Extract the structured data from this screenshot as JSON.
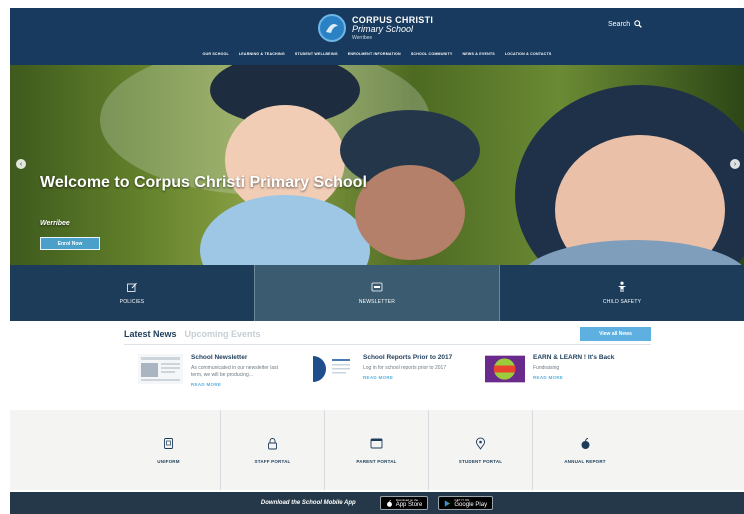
{
  "header": {
    "logo_line1": "CORPUS CHRISTI",
    "logo_line2": "Primary School",
    "logo_line3": "Werribee",
    "search_label": "Search",
    "nav": [
      "OUR SCHOOL",
      "LEARNING & TEACHING",
      "STUDENT WELLBEING",
      "ENROLMENT INFORMATION",
      "SCHOOL COMMUNITY",
      "NEWS & EVENTS",
      "LOCATION & CONTACTS"
    ]
  },
  "hero": {
    "title": "Welcome to Corpus Christi Primary School",
    "subtitle": "Werribee",
    "button": "Enrol Now"
  },
  "tiles": [
    {
      "label": "POLICIES",
      "icon": "edit-icon"
    },
    {
      "label": "NEWSLETTER",
      "icon": "pdf-icon"
    },
    {
      "label": "CHILD SAFETY",
      "icon": "child-icon"
    }
  ],
  "news": {
    "tab_active": "Latest News",
    "tab_inactive": "Upcoming Events",
    "view_all": "View all News",
    "items": [
      {
        "title": "School Newsletter",
        "body": "As communicated in our newsletter last term, we will be producing...",
        "more": "READ MORE"
      },
      {
        "title": "School Reports Prior to 2017",
        "body": "Log in for school reports prior to 2017",
        "more": "READ MORE"
      },
      {
        "title": "EARN & LEARN ! It's Back",
        "body": "Fundraising",
        "more": "READ MORE"
      }
    ]
  },
  "quick_links": [
    {
      "label": "UNIFORM",
      "icon": "shirt-icon"
    },
    {
      "label": "STAFF PORTAL",
      "icon": "lock-icon"
    },
    {
      "label": "PARENT PORTAL",
      "icon": "window-icon"
    },
    {
      "label": "STUDENT PORTAL",
      "icon": "map-pin-icon"
    },
    {
      "label": "ANNUAL REPORT",
      "icon": "apple-icon"
    }
  ],
  "footer": {
    "text": "Download the School Mobile App",
    "appstore_small": "Download on the",
    "appstore_big": "App Store",
    "googleplay_small": "GET IT ON",
    "googleplay_big": "Google Play"
  },
  "colors": {
    "navy": "#173a5e",
    "tile_dark": "#1d3c5a",
    "tile_mid": "#3b5b70",
    "accent": "#5db0df"
  }
}
